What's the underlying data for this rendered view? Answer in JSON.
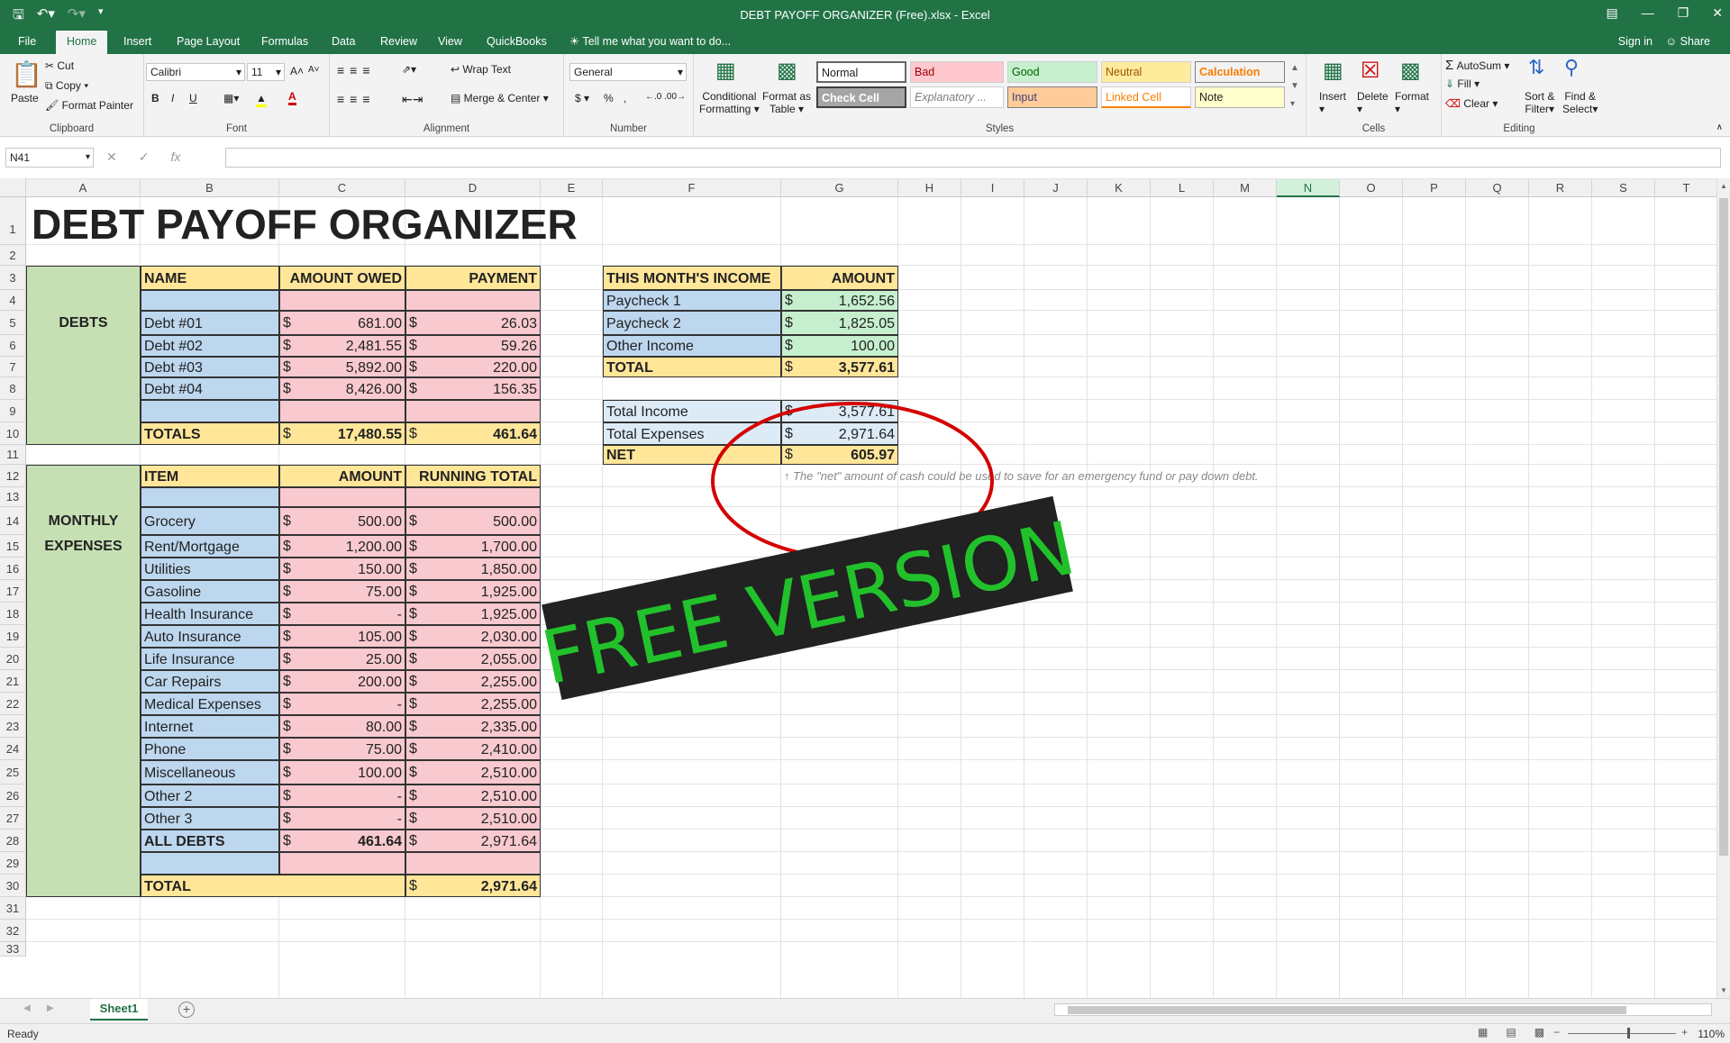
{
  "window": {
    "title": "DEBT PAYOFF ORGANIZER (Free).xlsx - Excel"
  },
  "tabs": [
    "File",
    "Home",
    "Insert",
    "Page Layout",
    "Formulas",
    "Data",
    "Review",
    "View",
    "QuickBooks"
  ],
  "tell_me": "Tell me what you want to do...",
  "sign_in": "Sign in",
  "share": "Share",
  "ribbon": {
    "clipboard": {
      "paste": "Paste",
      "cut": "Cut",
      "copy": "Copy",
      "format_painter": "Format Painter",
      "label": "Clipboard"
    },
    "font": {
      "name": "Calibri",
      "size": "11",
      "label": "Font"
    },
    "alignment": {
      "wrap": "Wrap Text",
      "merge": "Merge & Center",
      "label": "Alignment"
    },
    "number": {
      "format": "General",
      "label": "Number"
    },
    "styles": {
      "conditional": "Conditional",
      "formatting": "Formatting",
      "format_as": "Format as",
      "table": "Table",
      "normal": "Normal",
      "bad": "Bad",
      "good": "Good",
      "neutral": "Neutral",
      "calculation": "Calculation",
      "check_cell": "Check Cell",
      "explanatory": "Explanatory ...",
      "input": "Input",
      "linked_cell": "Linked Cell",
      "note": "Note",
      "label": "Styles"
    },
    "cells": {
      "insert": "Insert",
      "delete": "Delete",
      "format": "Format",
      "label": "Cells"
    },
    "editing": {
      "autosum": "AutoSum",
      "fill": "Fill",
      "clear": "Clear",
      "sort": "Sort &",
      "filter": "Filter",
      "find": "Find &",
      "select": "Select",
      "label": "Editing"
    }
  },
  "formula_bar": {
    "name_box": "N41",
    "formula": ""
  },
  "columns": [
    "A",
    "B",
    "C",
    "D",
    "E",
    "F",
    "G",
    "H",
    "I",
    "J",
    "K",
    "L",
    "M",
    "N",
    "O",
    "P",
    "Q",
    "R",
    "S",
    "T"
  ],
  "rows": [
    "1",
    "2",
    "3",
    "4",
    "5",
    "6",
    "7",
    "8",
    "9",
    "10",
    "11",
    "12",
    "13",
    "14",
    "15",
    "16",
    "17",
    "18",
    "19",
    "20",
    "21",
    "22",
    "23",
    "24",
    "25",
    "26",
    "27",
    "28",
    "29",
    "30",
    "31",
    "32",
    "33"
  ],
  "sheet": {
    "title": "DEBT PAYOFF ORGANIZER",
    "debts_label": "DEBTS",
    "debt_headers": {
      "name": "NAME",
      "owed": "AMOUNT OWED",
      "payment": "PAYMENT"
    },
    "debts": [
      {
        "name": "Debt #01",
        "owed": "681.00",
        "payment": "26.03"
      },
      {
        "name": "Debt #02",
        "owed": "2,481.55",
        "payment": "59.26"
      },
      {
        "name": "Debt #03",
        "owed": "5,892.00",
        "payment": "220.00"
      },
      {
        "name": "Debt #04",
        "owed": "8,426.00",
        "payment": "156.35"
      }
    ],
    "debt_totals": {
      "label": "TOTALS",
      "owed": "17,480.55",
      "payment": "461.64"
    },
    "expenses_label_1": "MONTHLY",
    "expenses_label_2": "EXPENSES",
    "expense_headers": {
      "item": "ITEM",
      "amount": "AMOUNT",
      "running": "RUNNING TOTAL"
    },
    "expenses": [
      {
        "item": "Grocery",
        "amount": "500.00",
        "running": "500.00"
      },
      {
        "item": "Rent/Mortgage",
        "amount": "1,200.00",
        "running": "1,700.00"
      },
      {
        "item": "Utilities",
        "amount": "150.00",
        "running": "1,850.00"
      },
      {
        "item": "Gasoline",
        "amount": "75.00",
        "running": "1,925.00"
      },
      {
        "item": "Health Insurance",
        "amount": "-",
        "running": "1,925.00"
      },
      {
        "item": "Auto Insurance",
        "amount": "105.00",
        "running": "2,030.00"
      },
      {
        "item": "Life Insurance",
        "amount": "25.00",
        "running": "2,055.00"
      },
      {
        "item": "Car Repairs",
        "amount": "200.00",
        "running": "2,255.00"
      },
      {
        "item": "Medical Expenses",
        "amount": "-",
        "running": "2,255.00"
      },
      {
        "item": "Internet",
        "amount": "80.00",
        "running": "2,335.00"
      },
      {
        "item": "Phone",
        "amount": "75.00",
        "running": "2,410.00"
      },
      {
        "item": "Miscellaneous",
        "amount": "100.00",
        "running": "2,510.00"
      },
      {
        "item": "Other 2",
        "amount": "-",
        "running": "2,510.00"
      },
      {
        "item": "Other 3",
        "amount": "-",
        "running": "2,510.00"
      }
    ],
    "all_debts": {
      "label": "ALL DEBTS",
      "amount": "461.64",
      "running": "2,971.64"
    },
    "expense_total": {
      "label": "TOTAL",
      "running": "2,971.64"
    },
    "income_headers": {
      "label": "THIS MONTH'S INCOME",
      "amount": "AMOUNT"
    },
    "income": [
      {
        "name": "Paycheck 1",
        "amount": "1,652.56"
      },
      {
        "name": "Paycheck 2",
        "amount": "1,825.05"
      },
      {
        "name": "Other Income",
        "amount": "100.00"
      }
    ],
    "income_total": {
      "label": "TOTAL",
      "amount": "3,577.61"
    },
    "summary": [
      {
        "name": "Total Income",
        "amount": "3,577.61"
      },
      {
        "name": "Total Expenses",
        "amount": "2,971.64"
      }
    ],
    "net": {
      "label": "NET",
      "amount": "605.97"
    },
    "note": "↑ The \"net\" amount of cash could be used to save for an emergency fund or pay down debt.",
    "currency": "$"
  },
  "watermark": "FREE VERSION",
  "sheet_tab": "Sheet1",
  "status": {
    "ready": "Ready",
    "zoom": "110%"
  },
  "colors": {
    "accent": "#217346",
    "circle": "#d40000",
    "watermark_text": "#22c12b",
    "watermark_bg": "#222222"
  }
}
